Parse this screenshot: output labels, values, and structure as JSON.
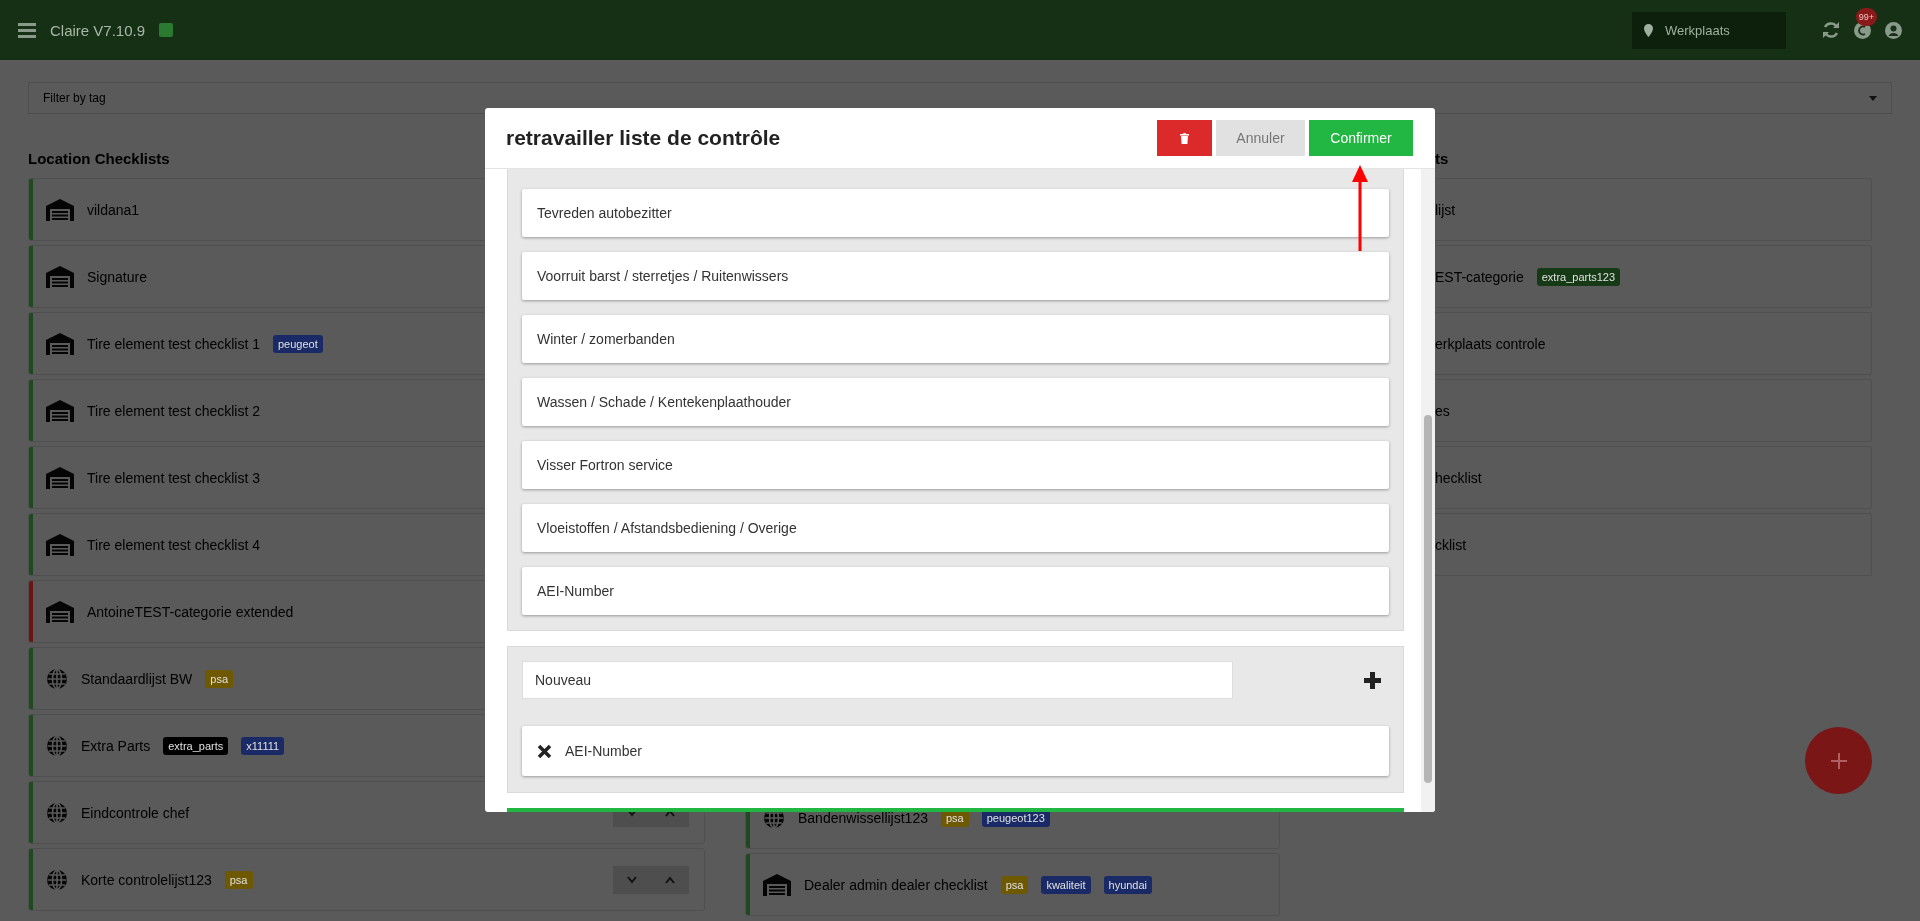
{
  "app_bar": {
    "title": "Claire V7.10.9",
    "location": {
      "value": "Werkplaats"
    },
    "notification_count": "99+"
  },
  "filter": {
    "placeholder": "Filter by tag"
  },
  "columns": [
    {
      "heading": "Location Checklists",
      "cards": [
        {
          "name": "vildana1",
          "kind": "garage",
          "color": "#1f4a1f"
        },
        {
          "name": "Signature",
          "kind": "garage",
          "color": "#1f4a1f"
        },
        {
          "name": "Tire element test checklist 1",
          "kind": "garage",
          "color": "#1f4a1f",
          "tags": [
            {
              "label": "peugeot",
              "color": "#1a2a66"
            }
          ]
        },
        {
          "name": "Tire element test checklist 2",
          "kind": "garage",
          "color": "#1f4a1f"
        },
        {
          "name": "Tire element test checklist 3",
          "kind": "garage",
          "color": "#1f4a1f"
        },
        {
          "name": "Tire element test checklist 4",
          "kind": "garage",
          "color": "#1f4a1f"
        },
        {
          "name": "AntoineTEST-categorie extended",
          "kind": "garage",
          "color": "#6a1414"
        },
        {
          "name": "Standaardlijst BW",
          "kind": "globe",
          "color": "#1f4a1f",
          "tags": [
            {
              "label": "psa",
              "color": "#6e5800"
            }
          ]
        },
        {
          "name": "Extra Parts",
          "kind": "globe",
          "color": "#1f4a1f",
          "tags": [
            {
              "label": "extra_parts",
              "color": "#000000"
            },
            {
              "label": "x11111",
              "color": "#1a2a66"
            }
          ]
        },
        {
          "name": "Eindcontrole chef",
          "kind": "globe",
          "color": "#1f4a1f",
          "reorder": true
        },
        {
          "name": "Korte controlelijst123",
          "kind": "globe",
          "color": "#1f4a1f",
          "reorder": true,
          "tags": [
            {
              "label": "psa",
              "color": "#6e5800"
            }
          ]
        }
      ]
    },
    {
      "cards": [
        {
          "name": "Bandenwissellijst123",
          "kind": "globe",
          "color": "#1f4a1f",
          "tags": [
            {
              "label": "psa",
              "color": "#6e5800"
            },
            {
              "label": "peugeot123",
              "color": "#1a2a66"
            }
          ]
        },
        {
          "name": "Dealer admin dealer checklist",
          "kind": "garage",
          "color": "#1f4a1f",
          "tags": [
            {
              "label": "psa",
              "color": "#6e5800"
            },
            {
              "label": "kwaliteit",
              "color": "#1a2a66"
            },
            {
              "label": "hyundai",
              "color": "#1a2a66"
            }
          ]
        }
      ]
    },
    {
      "heading": "ts",
      "cards": [
        {
          "name": "lijst"
        },
        {
          "name": "EST-categorie",
          "tags": [
            {
              "label": "extra_parts123",
              "color": "#163a16"
            }
          ]
        },
        {
          "name": "erkplaats controle"
        },
        {
          "name": "es"
        },
        {
          "name": "hecklist"
        },
        {
          "name": "cklist"
        }
      ]
    }
  ],
  "modal": {
    "title": "retravailler liste de contrôle",
    "buttons": [
      {
        "kind": "delete"
      },
      {
        "kind": "cancel",
        "label": "Annuler"
      },
      {
        "kind": "confirm",
        "label": "Confirmer"
      }
    ],
    "items": [
      "Tevreden autobezitter",
      "Voorruit barst / sterretjes / Ruitenwissers",
      "Winter / zomerbanden",
      "Wassen / Schade / Kentekenplaathouder",
      "Visser Fortron service",
      "Vloeistoffen / Afstandsbediening / Overige",
      "AEI-Number"
    ],
    "new_item": {
      "value": "Nouveau"
    },
    "added": [
      "AEI-Number"
    ]
  }
}
